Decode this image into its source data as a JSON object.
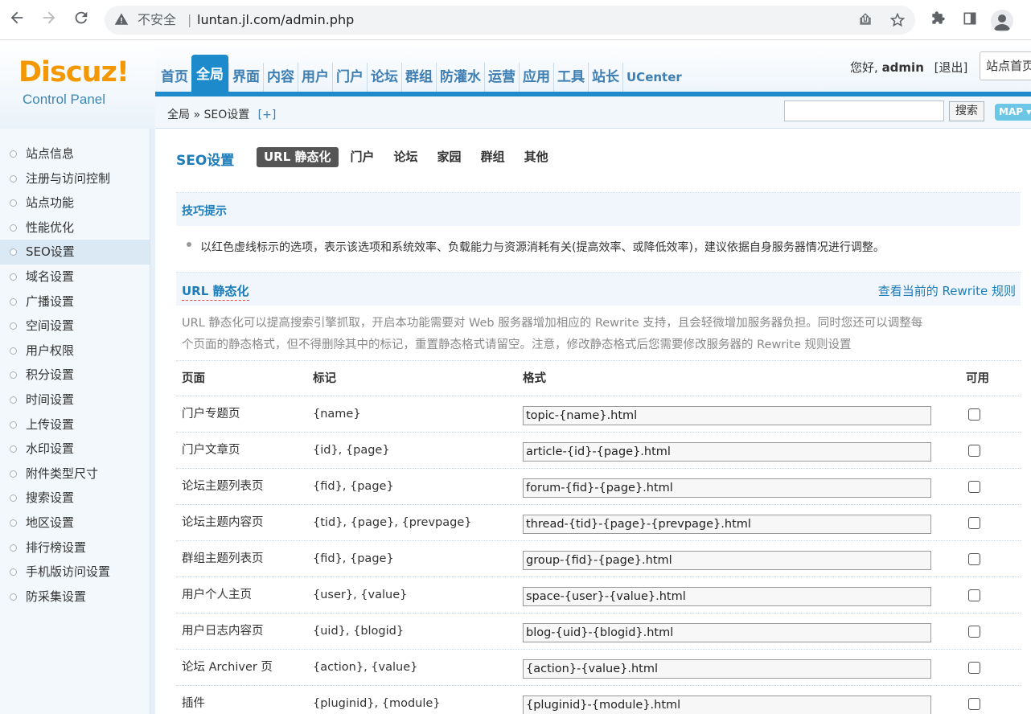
{
  "browser": {
    "insecure_label": "不安全",
    "separator": "|",
    "url": "luntan.jl.com/admin.php"
  },
  "logo": {
    "brand": "Discuz!",
    "subtitle": "Control Panel"
  },
  "nav": {
    "items": [
      "首页",
      "全局",
      "界面",
      "内容",
      "用户",
      "门户",
      "论坛",
      "群组",
      "防灌水",
      "运营",
      "应用",
      "工具",
      "站长",
      "UCenter"
    ],
    "active": "全局"
  },
  "user": {
    "greeting": "您好,",
    "name": "admin",
    "logout": "[退出]",
    "site_select": "站点首页"
  },
  "breadcrumb": {
    "text": "全局 » SEO设置",
    "plus": "[+]"
  },
  "search": {
    "value": "",
    "button": "搜索"
  },
  "map_button": "MAP ▾",
  "sidebar": {
    "items": [
      "站点信息",
      "注册与访问控制",
      "站点功能",
      "性能优化",
      "SEO设置",
      "域名设置",
      "广播设置",
      "空间设置",
      "用户权限",
      "积分设置",
      "时间设置",
      "上传设置",
      "水印设置",
      "附件类型尺寸",
      "搜索设置",
      "地区设置",
      "排行榜设置",
      "手机版访问设置",
      "防采集设置"
    ],
    "active": "SEO设置"
  },
  "page": {
    "title": "SEO设置",
    "tabs": [
      "URL 静态化",
      "门户",
      "论坛",
      "家园",
      "群组",
      "其他"
    ],
    "active_tab": "URL 静态化"
  },
  "tips": {
    "heading": "技巧提示",
    "text": "以红色虚线标示的选项，表示该选项和系统效率、负载能力与资源消耗有关(提高效率、或降低效率)，建议依据自身服务器情况进行调整。"
  },
  "section": {
    "title": "URL 静态化",
    "link": "查看当前的 Rewrite 规则",
    "description_line1": "URL 静态化可以提高搜索引擎抓取，开启本功能需要对 Web 服务器增加相应的 Rewrite 支持，且会轻微增加服务器负担。同时您还可以调整每",
    "description_line2": "个页面的静态格式，但不得删除其中的标记，重置静态格式请留空。注意，修改静态格式后您需要修改服务器的 Rewrite 规则设置"
  },
  "table": {
    "headers": {
      "page": "页面",
      "mark": "标记",
      "format": "格式",
      "enabled": "可用"
    },
    "rows": [
      {
        "page": "门户专题页",
        "mark": "{name}",
        "format": "topic-{name}.html",
        "enabled": false
      },
      {
        "page": "门户文章页",
        "mark": "{id}, {page}",
        "format": "article-{id}-{page}.html",
        "enabled": false
      },
      {
        "page": "论坛主题列表页",
        "mark": "{fid}, {page}",
        "format": "forum-{fid}-{page}.html",
        "enabled": false
      },
      {
        "page": "论坛主题内容页",
        "mark": "{tid}, {page}, {prevpage}",
        "format": "thread-{tid}-{page}-{prevpage}.html",
        "enabled": false
      },
      {
        "page": "群组主题列表页",
        "mark": "{fid}, {page}",
        "format": "group-{fid}-{page}.html",
        "enabled": false
      },
      {
        "page": "用户个人主页",
        "mark": "{user}, {value}",
        "format": "space-{user}-{value}.html",
        "enabled": false
      },
      {
        "page": "用户日志内容页",
        "mark": "{uid}, {blogid}",
        "format": "blog-{uid}-{blogid}.html",
        "enabled": false
      },
      {
        "page": "论坛 Archiver 页",
        "mark": "{action}, {value}",
        "format": "{action}-{value}.html",
        "enabled": false
      },
      {
        "page": "插件",
        "mark": "{pluginid}, {module}",
        "format": "{pluginid}-{module}.html",
        "enabled": false
      }
    ]
  },
  "icons": [
    "back-arrow-icon",
    "forward-arrow-icon",
    "reload-icon",
    "warning-icon",
    "share-icon",
    "star-icon",
    "puzzle-icon",
    "sidepanel-icon",
    "profile-icon"
  ]
}
